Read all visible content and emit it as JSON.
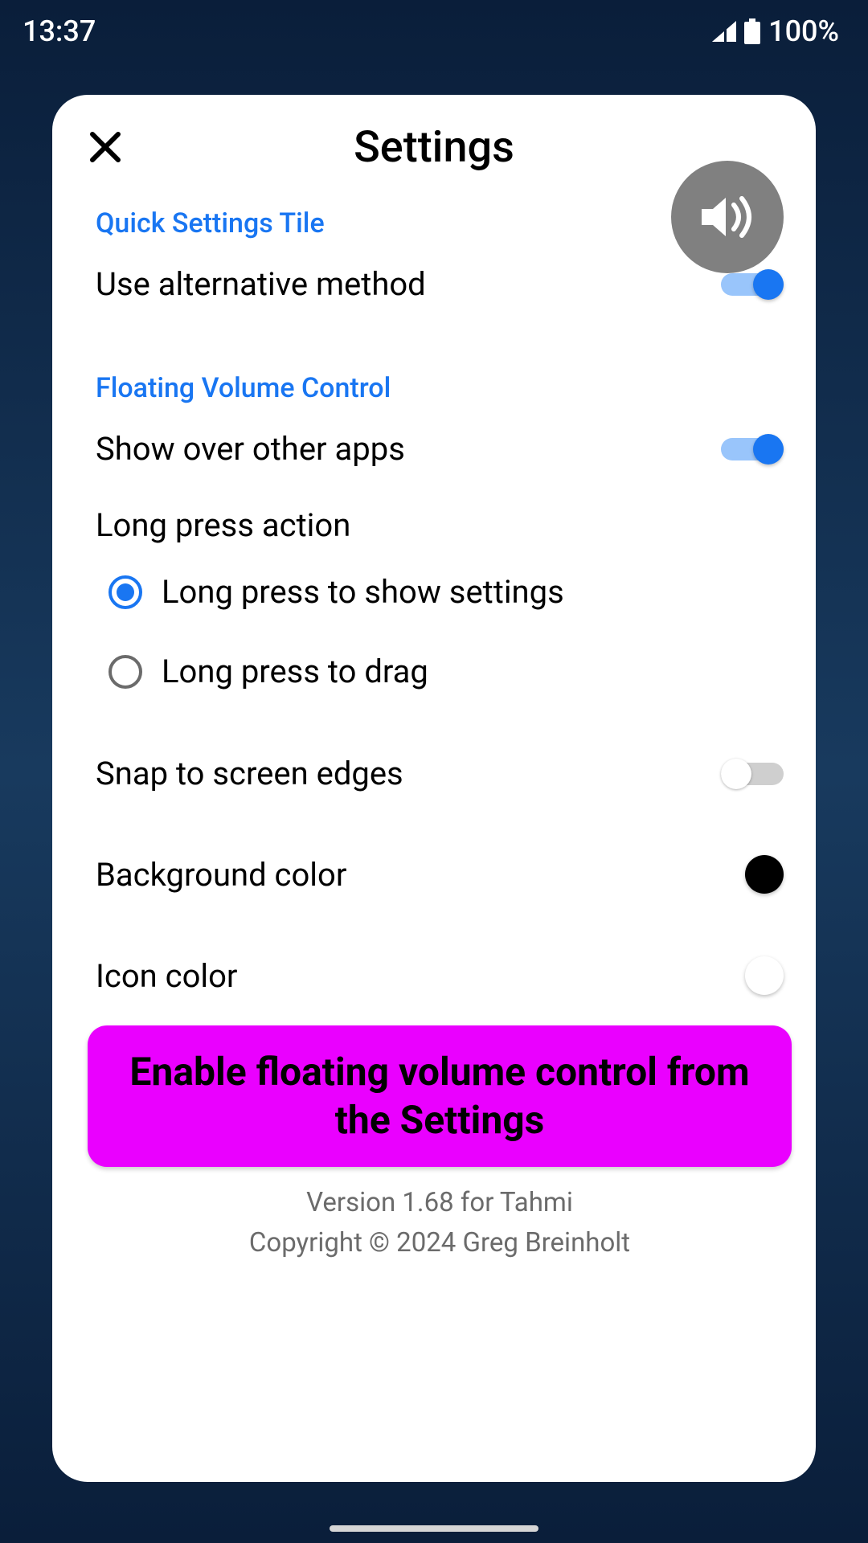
{
  "status": {
    "time": "13:37",
    "battery": "100%"
  },
  "header": {
    "title": "Settings"
  },
  "sections": {
    "quick_tile": {
      "title": "Quick Settings Tile",
      "alt_method": "Use alternative method"
    },
    "floating": {
      "title": "Floating Volume Control",
      "show_over": "Show over other apps",
      "long_press_label": "Long press action",
      "radio_settings": "Long press to show settings",
      "radio_drag": "Long press to drag",
      "snap": "Snap to screen edges",
      "bg_color_label": "Background color",
      "icon_color_label": "Icon color"
    }
  },
  "toggles": {
    "alt_method": true,
    "show_over": true,
    "snap": false
  },
  "radio": {
    "selected": "settings"
  },
  "colors": {
    "background": "#000000",
    "icon": "#ffffff",
    "accent": "#1976f2",
    "banner": "#ea00ff"
  },
  "banner": {
    "text": "Enable floating volume control from the Settings"
  },
  "footer": {
    "version": "Version 1.68 for Tahmi",
    "copyright": "Copyright © 2024 Greg Breinholt"
  }
}
